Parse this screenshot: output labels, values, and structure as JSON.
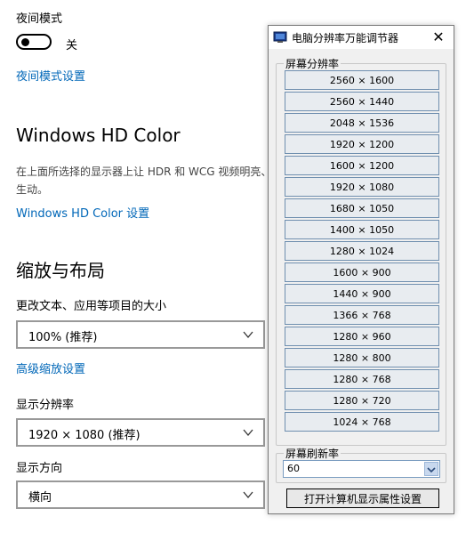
{
  "settings": {
    "night_mode_label": "夜间模式",
    "night_mode_state": "关",
    "night_mode_settings_link": "夜间模式设置",
    "hdr_heading": "Windows HD Color",
    "hdr_desc": "在上面所选择的显示器上让 HDR 和 WCG 视频明亮、更生动。",
    "hdr_settings_link": "Windows HD Color 设置",
    "scale_heading": "缩放与布局",
    "text_size_label": "更改文本、应用等项目的大小",
    "text_size_value": "100% (推荐)",
    "advanced_scale_link": "高级缩放设置",
    "resolution_label": "显示分辨率",
    "resolution_value": "1920 × 1080 (推荐)",
    "orientation_label": "显示方向",
    "orientation_value": "横向"
  },
  "tool": {
    "title": "电脑分辨率万能调节器",
    "close_glyph": "✕",
    "resolution_group_label": "屏幕分辨率",
    "resolutions": [
      "2560 × 1600",
      "2560 × 1440",
      "2048 × 1536",
      "1920 × 1200",
      "1600 × 1200",
      "1920 × 1080",
      "1680 × 1050",
      "1400 × 1050",
      "1280 × 1024",
      "1600 × 900",
      "1440 × 900",
      "1366 × 768",
      "1280 × 960",
      "1280 × 800",
      "1280 × 768",
      "1280 × 720",
      "1024 × 768"
    ],
    "refresh_group_label": "屏幕刷新率",
    "refresh_value": "60",
    "open_props_button": "打开计算机显示属性设置"
  }
}
